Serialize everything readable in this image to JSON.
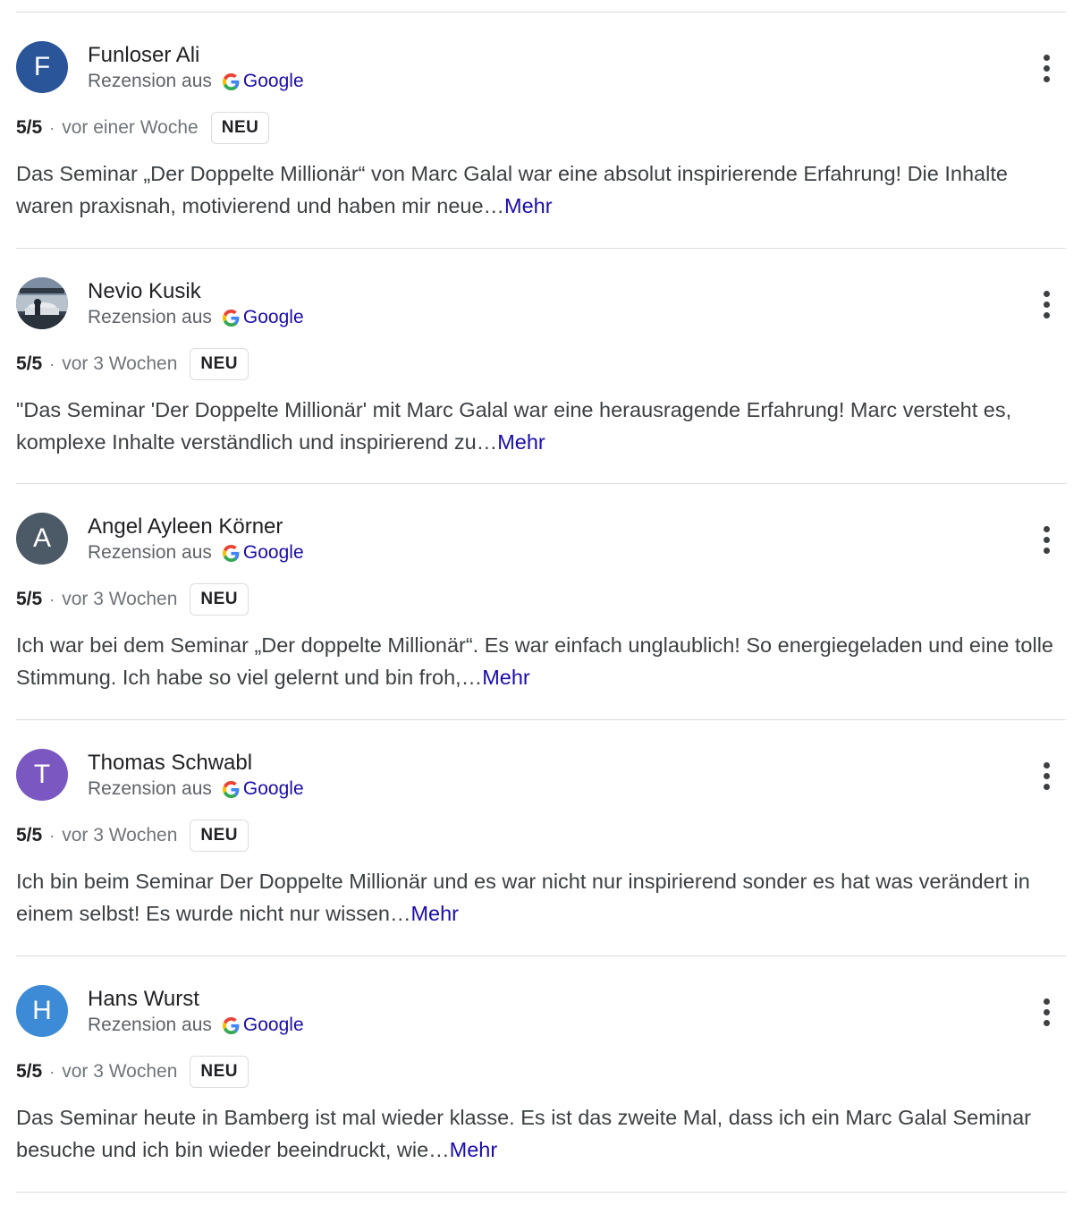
{
  "colors": {
    "google_blue": "#4285F4",
    "google_red": "#EA4335",
    "google_yellow": "#FBBC05",
    "google_green": "#34A853",
    "link": "#1a0dab"
  },
  "reviews": [
    {
      "initial": "F",
      "avatar_color": "#2a5699",
      "avatar_type": "letter",
      "name": "Funloser Ali",
      "source_label": "Rezension aus",
      "source_name": "Google",
      "rating": "5/5",
      "separator": "·",
      "date": "vor einer Woche",
      "badge": "NEU",
      "text": "Das Seminar „Der Doppelte Millionär“ von Marc Galal war eine absolut inspirierende Erfahrung! Die Inhalte waren praxisnah, motivierend und haben mir neue…",
      "more_label": "Mehr"
    },
    {
      "initial": "",
      "avatar_color": "",
      "avatar_type": "photo",
      "name": "Nevio Kusik",
      "source_label": "Rezension aus",
      "source_name": "Google",
      "rating": "5/5",
      "separator": "·",
      "date": "vor 3 Wochen",
      "badge": "NEU",
      "text": "\"Das Seminar 'Der Doppelte Millionär' mit Marc Galal war eine herausragende Erfahrung! Marc versteht es, komplexe Inhalte verständlich und inspirierend zu…",
      "more_label": "Mehr"
    },
    {
      "initial": "A",
      "avatar_color": "#4b5a66",
      "avatar_type": "letter",
      "name": "Angel Ayleen Körner",
      "source_label": "Rezension aus",
      "source_name": "Google",
      "rating": "5/5",
      "separator": "·",
      "date": "vor 3 Wochen",
      "badge": "NEU",
      "text": "Ich war bei dem Seminar „Der doppelte Millionär“. Es war einfach unglaublich! So energiegeladen und eine tolle Stimmung. Ich habe so viel gelernt und bin froh,…",
      "more_label": "Mehr"
    },
    {
      "initial": "T",
      "avatar_color": "#7b57c1",
      "avatar_type": "letter",
      "name": "Thomas Schwabl",
      "source_label": "Rezension aus",
      "source_name": "Google",
      "rating": "5/5",
      "separator": "·",
      "date": "vor 3 Wochen",
      "badge": "NEU",
      "text": "Ich bin beim Seminar Der Doppelte Millionär und es war nicht nur inspirierend sonder es hat was verändert in einem selbst! Es wurde nicht nur wissen…",
      "more_label": "Mehr"
    },
    {
      "initial": "H",
      "avatar_color": "#3d8ad6",
      "avatar_type": "letter",
      "name": "Hans Wurst",
      "source_label": "Rezension aus",
      "source_name": "Google",
      "rating": "5/5",
      "separator": "·",
      "date": "vor 3 Wochen",
      "badge": "NEU",
      "text": "Das Seminar heute in Bamberg ist mal wieder klasse. Es ist das zweite Mal, dass ich ein Marc Galal Seminar besuche und ich bin wieder beeindruckt, wie…",
      "more_label": "Mehr"
    }
  ]
}
